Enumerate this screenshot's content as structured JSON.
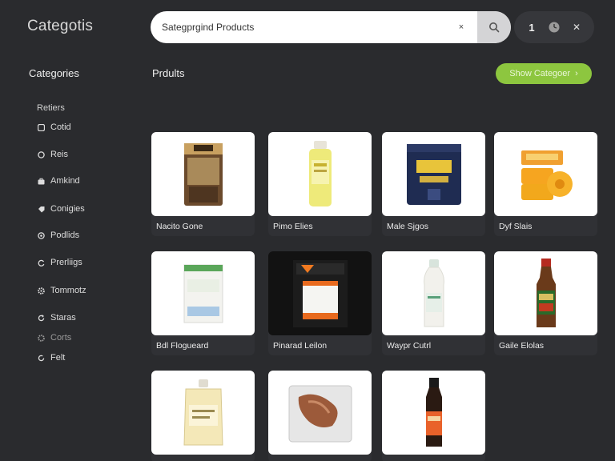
{
  "app": {
    "title": "Categotis"
  },
  "search": {
    "value": "Sategprgind Products",
    "clear_label": "×"
  },
  "toolbar": {
    "icons": [
      "info-icon",
      "clock-icon",
      "close-icon"
    ],
    "info_label": "1",
    "close_label": "✕"
  },
  "sidebar": {
    "heading": "Categories",
    "subheading": "Retiers",
    "items": [
      {
        "label": "Cotid",
        "icon": "square-icon"
      },
      {
        "label": "Reis",
        "icon": "circle-icon"
      },
      {
        "label": "Amkind",
        "icon": "bag-icon"
      },
      {
        "label": "Conigies",
        "icon": "tag-icon"
      },
      {
        "label": "Podlids",
        "icon": "circle-icon"
      },
      {
        "label": "Prerliigs",
        "icon": "loop-icon"
      },
      {
        "label": "Tommotz",
        "icon": "gear-icon"
      },
      {
        "label": "Staras",
        "icon": "refresh-icon"
      },
      {
        "label": "Corts",
        "icon": "gear-icon"
      },
      {
        "label": "Felt",
        "icon": "refresh-icon"
      }
    ]
  },
  "main": {
    "heading": "Prdults",
    "cta_label": "Show Categoer",
    "products": [
      {
        "name": "Nacito Gone",
        "image": "brown-pouch"
      },
      {
        "name": "Pimo Elies",
        "image": "yellow-bottle"
      },
      {
        "name": "Male Sjgos",
        "image": "navy-bag"
      },
      {
        "name": "Dyf Slais",
        "image": "orange-rolls"
      },
      {
        "name": "Bdl Flogueard",
        "image": "white-box"
      },
      {
        "name": "Pinarad Leilon",
        "image": "black-box"
      },
      {
        "name": "Waypr Cutrl",
        "image": "white-bottle"
      },
      {
        "name": "Gaile Elolas",
        "image": "sauce-bottle"
      },
      {
        "name": "",
        "image": "clear-pouch"
      },
      {
        "name": "",
        "image": "wrapped-pack"
      },
      {
        "name": "",
        "image": "dark-bottle"
      }
    ]
  },
  "colors": {
    "background": "#2a2b2e",
    "accent": "#8dc63f",
    "card": "#303135"
  }
}
